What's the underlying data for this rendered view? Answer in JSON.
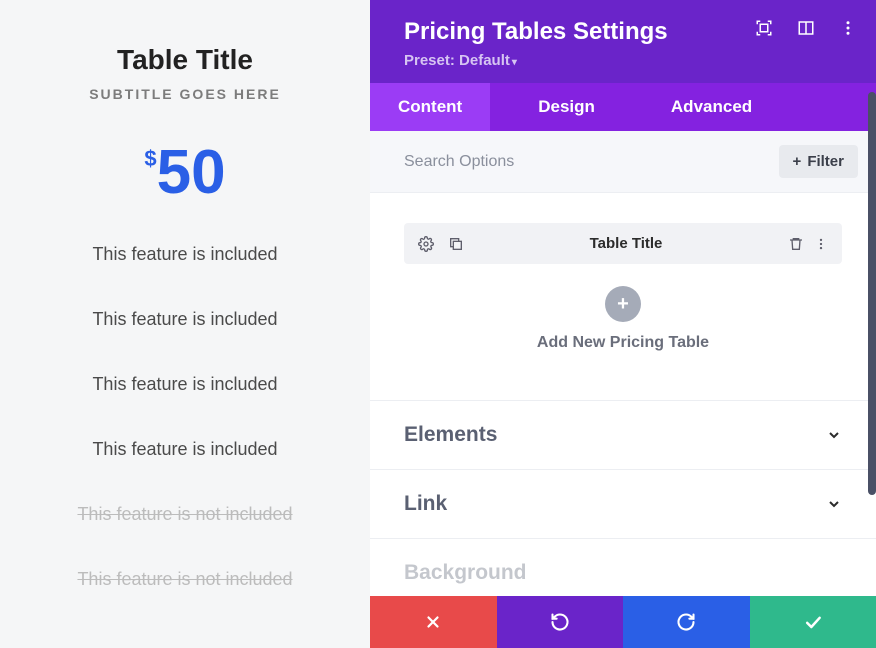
{
  "preview": {
    "title": "Table Title",
    "subtitle": "SUBTITLE GOES HERE",
    "currency": "$",
    "amount": "50",
    "features": [
      {
        "text": "This feature is included",
        "excluded": false
      },
      {
        "text": "This feature is included",
        "excluded": false
      },
      {
        "text": "This feature is included",
        "excluded": false
      },
      {
        "text": "This feature is included",
        "excluded": false
      },
      {
        "text": "This feature is not included",
        "excluded": true
      },
      {
        "text": "This feature is not included",
        "excluded": true
      }
    ]
  },
  "panel": {
    "title": "Pricing Tables Settings",
    "preset_label": "Preset: Default",
    "tabs": [
      "Content",
      "Design",
      "Advanced"
    ],
    "active_tab": 0,
    "search_placeholder": "Search Options",
    "filter_label": "Filter",
    "item_label": "Table Title",
    "add_label": "Add New Pricing Table",
    "accordion": [
      "Elements",
      "Link",
      "Background"
    ]
  }
}
